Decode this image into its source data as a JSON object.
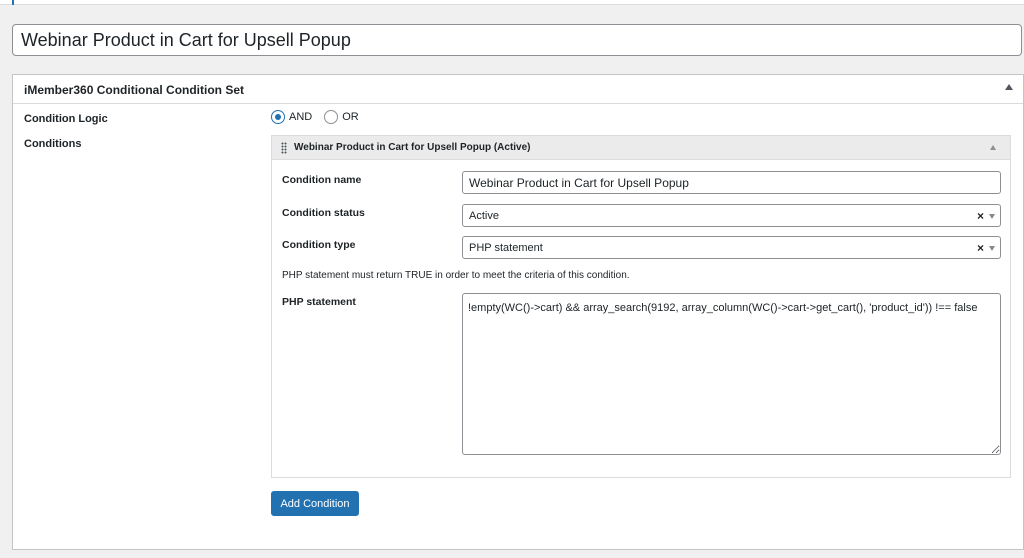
{
  "post": {
    "title": "Webinar Product in Cart for Upsell Popup"
  },
  "metabox": {
    "title": "iMember360 Conditional Condition Set",
    "logic_label": "Condition Logic",
    "logic_options": [
      {
        "label": "AND",
        "checked": true
      },
      {
        "label": "OR",
        "checked": false
      }
    ],
    "conditions_label": "Conditions",
    "condition": {
      "header": "Webinar Product in Cart for Upsell Popup (Active)",
      "name_label": "Condition name",
      "name_value": "Webinar Product in Cart for Upsell Popup",
      "status_label": "Condition status",
      "status_value": "Active",
      "type_label": "Condition type",
      "type_value": "PHP statement",
      "help_text": "PHP statement must return TRUE in order to meet the criteria of this condition.",
      "php_label": "PHP statement",
      "php_value": "!empty(WC()->cart) && array_search(9192, array_column(WC()->cart->get_cart(), 'product_id')) !== false"
    },
    "add_button": "Add Condition",
    "clear_symbol": "×"
  },
  "colors": {
    "primary": "#2271b1",
    "background": "#f0f0f1",
    "border": "#c3c4c7"
  }
}
